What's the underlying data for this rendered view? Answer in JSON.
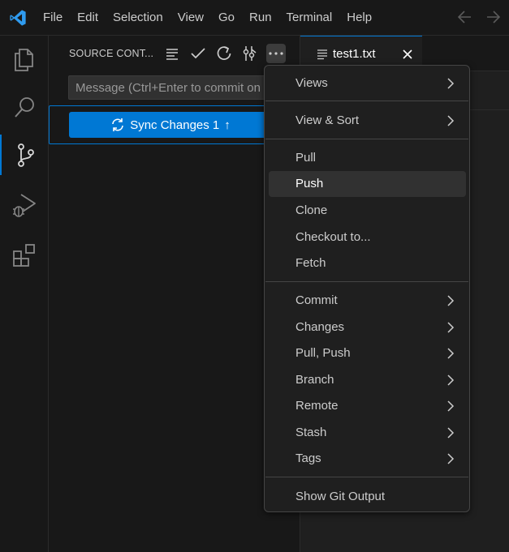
{
  "menubar": {
    "items": [
      "File",
      "Edit",
      "Selection",
      "View",
      "Go",
      "Run",
      "Terminal",
      "Help"
    ]
  },
  "sidebar": {
    "title": "SOURCE CONT...",
    "commit_placeholder": "Message (Ctrl+Enter to commit on 'main')",
    "sync_button": {
      "label": "Sync Changes 1",
      "arrow": "↑"
    }
  },
  "editor": {
    "tab": {
      "label": "test1.txt"
    }
  },
  "context_menu": {
    "items": [
      {
        "label": "Views",
        "submenu": true
      },
      {
        "label": "View & Sort",
        "submenu": true
      },
      {
        "label": "Pull",
        "submenu": false
      },
      {
        "label": "Push",
        "submenu": false,
        "highlighted": true
      },
      {
        "label": "Clone",
        "submenu": false
      },
      {
        "label": "Checkout to...",
        "submenu": false
      },
      {
        "label": "Fetch",
        "submenu": false
      },
      {
        "label": "Commit",
        "submenu": true
      },
      {
        "label": "Changes",
        "submenu": true
      },
      {
        "label": "Pull, Push",
        "submenu": true
      },
      {
        "label": "Branch",
        "submenu": true
      },
      {
        "label": "Remote",
        "submenu": true
      },
      {
        "label": "Stash",
        "submenu": true
      },
      {
        "label": "Tags",
        "submenu": true
      },
      {
        "label": "Show Git Output",
        "submenu": false
      }
    ]
  },
  "colors": {
    "accent": "#0078d4",
    "background": "#181818",
    "menu_background": "#1f1f1f",
    "highlight": "#313131"
  }
}
